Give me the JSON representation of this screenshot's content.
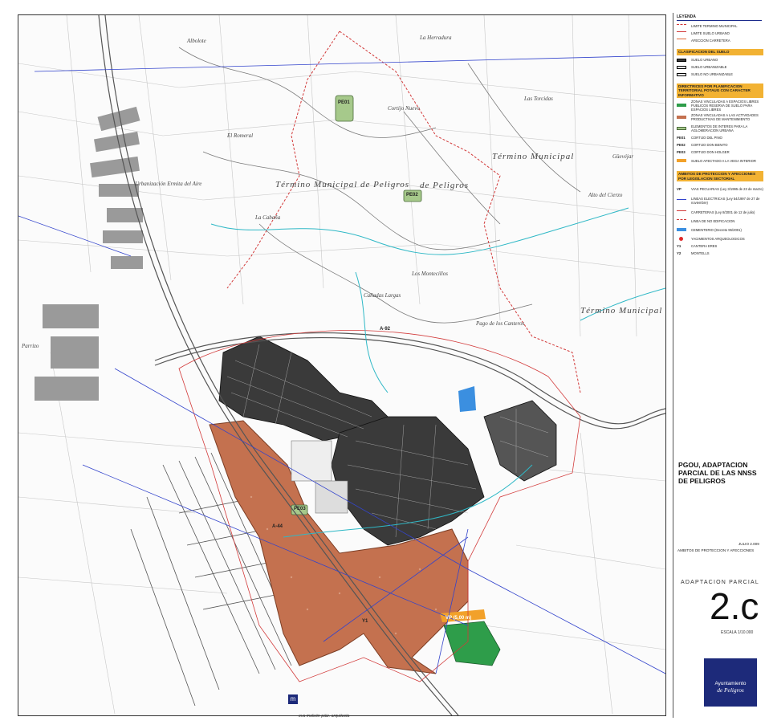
{
  "map": {
    "places": [
      {
        "key": "albolote",
        "text": "Albolote"
      },
      {
        "key": "la_herradura",
        "text": "La Herradura"
      },
      {
        "key": "el_romeral",
        "text": "El Romeral"
      },
      {
        "key": "las_torcidas",
        "text": "Las Torcidas"
      },
      {
        "key": "termino_municipal_1",
        "text": "Término Municipal"
      },
      {
        "key": "de_peligros",
        "text": "de Peligros"
      },
      {
        "key": "termino_municipal_2",
        "text": "Término Municipal de Peligros"
      },
      {
        "key": "la_cabana",
        "text": "La Cabaña"
      },
      {
        "key": "los_montecillos",
        "text": "Los Montecillos"
      },
      {
        "key": "canadas_largas",
        "text": "Cañadas Largas"
      },
      {
        "key": "pago_canteras",
        "text": "Pago de los Canteros"
      },
      {
        "key": "termino_guevejar",
        "text": "Término Municipal de Güevéjar"
      },
      {
        "key": "alto_cierzo",
        "text": "Alto del Cierzo"
      },
      {
        "key": "cortijo_nuevo",
        "text": "Cortijo Nuevo"
      },
      {
        "key": "urbanizacion",
        "text": "Urbanización Ermita del Aire"
      },
      {
        "key": "guevejar_top",
        "text": "Güevéjar"
      },
      {
        "key": "parrizo",
        "text": "Parrizo"
      }
    ],
    "badges": {
      "pe01": "PE01",
      "pe02": "PE02",
      "pe03": "PE03",
      "a92": "A-92",
      "a44": "A-44",
      "vp": "VP (5,00 m)",
      "y1": "Y1"
    },
    "colors": {
      "urban_fill": "#3a3a3a",
      "sector_fill": "#c4714f",
      "green_zone": "#2e9d4a",
      "orange_zone": "#f2a12a",
      "boundary": "#d23a3a",
      "river": "#2fb8c6",
      "road_blue": "#3344cc"
    }
  },
  "legend": {
    "title": "LEYENDA",
    "boundary_items": [
      "LIMITE TERMINO MUNICIPAL",
      "LIMITE SUELO URBANO",
      "AFECCION CARRETERA"
    ],
    "soil_head": "CLASIFICACION DEL SUELO",
    "soil_items": [
      "SUELO URBANO",
      "SUELO URBANIZABLE",
      "SUELO NO URBANIZABLE"
    ],
    "directives_head": "DIRECTRICES POR PLANIFICACION TERRITORIAL POTAUG CON CARACTER INFORMATIVO",
    "directives_items": [
      "ZONAS VINCULADAS A ESPACIOS LIBRES PUBLICOS RESERVA DE SUELO PARA ESPACIOS LIBRES",
      "ZONAS VINCULADAS A LAS ACTIVIDADES PRODUCTIVAS DE MANTENIMIENTO",
      "ELEMENTOS DE INTERES PARA LA AGLOMERACION URBANA",
      "CORTIJO DEL PINO",
      "CORTIJO DON BENITO",
      "CORTIJO DON HOLGER",
      "SUELO AFECTADO A LA VEGA INTERIOR"
    ],
    "directive_codes": [
      "PE01",
      "PE02",
      "PE03"
    ],
    "protection_head": "AMBITOS DE PROTECCION Y AFECCIONES POR LEGISLACION SECTORIAL",
    "protection_items": [
      "VIAS PECUARIAS (Ley 3/1995 de 23 de marzo)",
      "LINEAS ELECTRICAS (Ley 54/1997 de 27 de noviembre)",
      "CARRETERAS (Ley 8/2001 de 12 de julio)",
      "LINEA DE NO EDIFICACION",
      "CEMENTERIO (Decreto 95/2001)",
      "YACIMIENTOS ARQUEOLOGICOS",
      "CANTERA ERES",
      "MONTELLS"
    ],
    "protection_codes": [
      "VP",
      "Y1",
      "Y2"
    ]
  },
  "title_block": {
    "title_line1": "PGOU, ADAPTACION",
    "title_line2": "PARCIAL DE LAS NNSS",
    "title_line3": "DE PELIGROS",
    "date": "JULIO 2.009",
    "subtitle": "AMBITOS DE PROTECCION Y AFECCIONES",
    "adaptation": "ADAPTACION PARCIAL",
    "sheet_number": "2.c",
    "scale": "ESCALA 1/10.000"
  },
  "logo": {
    "line1": "Ayuntamiento",
    "line2": "de Peligros"
  },
  "author": "eva moleón páiz. arquitecta"
}
